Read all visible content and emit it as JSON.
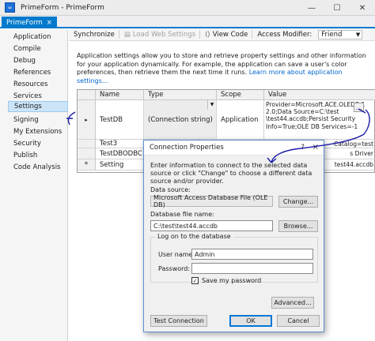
{
  "window": {
    "title": "PrimeForm - PrimeForm",
    "controls": [
      "minimize-icon",
      "maximize-icon",
      "close-icon"
    ]
  },
  "doc_tab": {
    "label": "PrimeForm",
    "close": "×"
  },
  "sidebar": {
    "items": [
      {
        "label": "Application"
      },
      {
        "label": "Compile"
      },
      {
        "label": "Debug"
      },
      {
        "label": "References"
      },
      {
        "label": "Resources"
      },
      {
        "label": "Services"
      },
      {
        "label": "Settings",
        "selected": true
      },
      {
        "label": "Signing"
      },
      {
        "label": "My Extensions"
      },
      {
        "label": "Security"
      },
      {
        "label": "Publish"
      },
      {
        "label": "Code Analysis"
      }
    ]
  },
  "toolbar": {
    "synchronize": "Synchronize",
    "load_web_settings": "Load Web Settings",
    "view_code": "View Code",
    "access_modifier_label": "Access Modifier:",
    "access_modifier_value": "Friend"
  },
  "description": {
    "text": "Application settings allow you to store and retrieve property settings and other information for your application dynamically. For example, the application can save a user's color preferences, then retrieve them the next time it runs.",
    "link": "Learn more about application settings..."
  },
  "grid": {
    "headers": [
      "Name",
      "Type",
      "Scope",
      "Value"
    ],
    "rows": [
      {
        "marker": "▸",
        "name": "TestDB",
        "type": "(Connection string)",
        "scope": "Application",
        "value": "Provider=Microsoft.ACE.OLEDB.1\n2.0;Data Source=C:\\test\n\\test44.accdb;Persist Security\nInfo=True;OLE DB Services=-1"
      },
      {
        "marker": "",
        "name": "Test3",
        "type": "",
        "scope": "",
        "value": "Catalog=test"
      },
      {
        "marker": "",
        "name": "TestDBODBC",
        "type": "",
        "scope": "",
        "value": "s Driver"
      },
      {
        "marker": "*",
        "name": "Setting",
        "type": "",
        "scope": "",
        "value": "test44.accdb"
      }
    ],
    "ellipsis": "..."
  },
  "dialog": {
    "title": "Connection Properties",
    "help": "?",
    "close": "×",
    "info": "Enter information to connect to the selected data source or click \"Change\" to choose a different data source and/or provider.",
    "data_source_label": "Data source:",
    "data_source_value": "Microsoft Access Database File (OLE DB)",
    "change_button": "Change...",
    "db_file_label": "Database file name:",
    "db_file_value": "C:\\test\\test44.accdb",
    "browse_button": "Browse...",
    "logon_group": "Log on to the database",
    "user_label": "User name:",
    "user_value": "Admin",
    "password_label": "Password:",
    "password_value": "",
    "save_password_label": "Save my password",
    "save_password_checked": "✓",
    "advanced_button": "Advanced...",
    "test_button": "Test Connection",
    "ok_button": "OK",
    "cancel_button": "Cancel"
  },
  "colors": {
    "accent": "#007acc",
    "selection": "#cce4f7",
    "annotation": "#1a1aa6"
  }
}
